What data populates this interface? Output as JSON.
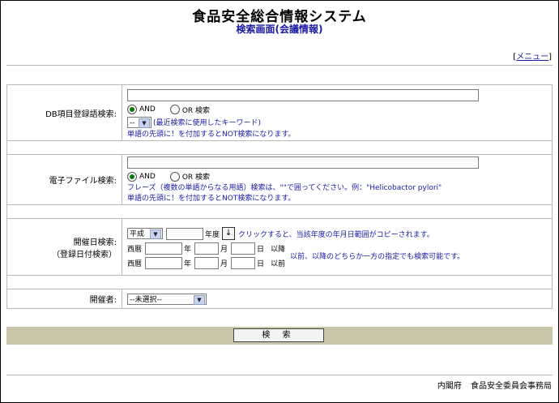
{
  "header": {
    "title": "食品安全総合情報システム",
    "subtitle": "検索画面(会議情報)",
    "menu_link": "メニュー"
  },
  "db_search": {
    "label": "DB項目登録語検索:",
    "and_label": "AND",
    "or_label": "OR 検索",
    "history_select": "--",
    "history_note": "(最近検索に使用したキーワード)",
    "not_note": "単語の先頭に！を付加するとNOT検索になります。"
  },
  "file_search": {
    "label": "電子ファイル検索:",
    "and_label": "AND",
    "or_label": "OR 検索",
    "phrase_note": "フレーズ（複数の単語からなる用語）検索は、\"\"で囲ってください。例：\"Helicobactor pylori\"",
    "not_note": "単語の先頭に！を付加するとNOT検索になります。"
  },
  "date_search": {
    "label": "開催日検索:",
    "label2": "（登録日付検索）",
    "era": "平成",
    "year_unit": "年度",
    "copy_button": "↓",
    "copy_note": "クリックすると、当該年度の年月日範囲がコピーされます。",
    "seireki": "西暦",
    "year": "年",
    "month": "月",
    "day": "日",
    "after": "以降",
    "before": "以前",
    "range_note": "以前、以降のどちらか一方の指定でも検索可能です。"
  },
  "host": {
    "label": "開催者:",
    "select_value": "--未選択--"
  },
  "search_button": "検 索",
  "footer": {
    "org1": "内閣府",
    "org2": "食品安全委員会事務局"
  }
}
